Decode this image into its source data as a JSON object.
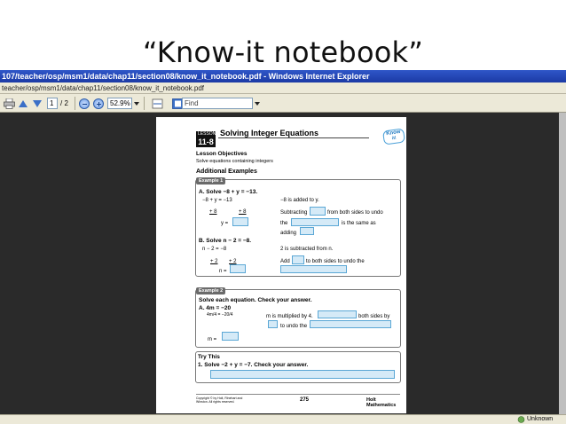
{
  "slide": {
    "title": "“Know-it notebook”"
  },
  "window": {
    "title": "107/teacher/osp/msm1/data/chap11/section08/know_it_notebook.pdf - Windows Internet Explorer",
    "address": "teacher/osp/msm1/data/chap11/section08/know_it_notebook.pdf"
  },
  "toolbar": {
    "page_current": "1",
    "page_total": "/ 2",
    "zoom": "52.9%",
    "find_placeholder": "Find"
  },
  "document": {
    "lesson_label": "LESSON",
    "lesson_number": "11-8",
    "title": "Solving Integer Equations",
    "logo_line1": "Know",
    "logo_line2": "it!",
    "objectives_heading": "Lesson Objectives",
    "objectives_text": "Solve equations containing integers",
    "examples_heading": "Additional Examples",
    "example1_tab": "Example 1",
    "ex1a_prompt": "A. Solve −8 + y = −13.",
    "ex1a_eq1": "−8 + y = −13",
    "ex1a_note1": "−8 is added to y.",
    "ex1a_eq2_left": "+ 8",
    "ex1a_eq2_right": "+ 8",
    "ex1a_note2a": "Subtracting",
    "ex1a_note2b": "from both sides to undo",
    "ex1a_eq3": "y =",
    "ex1a_note3a": "the",
    "ex1a_note3b": "is the same as",
    "ex1a_note4": "adding",
    "ex1b_prompt": "B. Solve n − 2 = −8.",
    "ex1b_eq1": "n − 2 = −8",
    "ex1b_note1": "2 is subtracted from n.",
    "ex1b_eq2_left": "+ 2",
    "ex1b_eq2_right": "+ 2",
    "ex1b_note2a": "Add",
    "ex1b_note2b": "to both sides to undo the",
    "ex1b_eq3": "n =",
    "example2_tab": "Example 2",
    "ex2_prompt": "Solve each equation. Check your answer.",
    "ex2a_prompt": "A. 4m = −20",
    "ex2a_frac": "4m/4 = −20/4",
    "ex2a_note1a": "m is multiplied by 4.",
    "ex2a_note1b": "both sides by",
    "ex2a_note2": "to undo the",
    "ex2a_eq3": "m =",
    "try_heading": "Try This",
    "try_prompt": "1. Solve −2 + y = −7. Check your answer.",
    "footer_copyright": "Copyright © by Holt, Rinehart and Winston. All rights reserved.",
    "footer_page": "275",
    "footer_book": "Holt Mathematics"
  },
  "status": {
    "zone": "Unknown Zone"
  }
}
